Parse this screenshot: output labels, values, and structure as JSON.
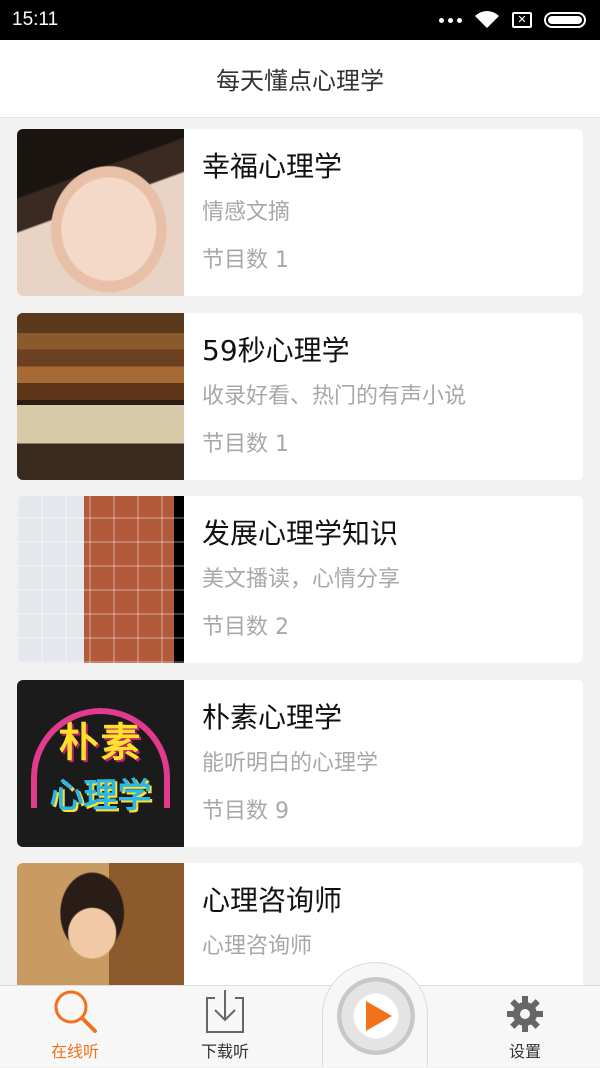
{
  "status_bar": {
    "time": "15:11",
    "icons": [
      "more-dots-icon",
      "wifi-icon",
      "sim-off-icon",
      "battery-icon"
    ]
  },
  "header": {
    "title": "每天懂点心理学"
  },
  "programs": [
    {
      "name": "幸福心理学",
      "desc": "情感文摘",
      "count": "节目数 1"
    },
    {
      "name": "59秒心理学",
      "desc": "收录好看、热门的有声小说",
      "count": "节目数 1"
    },
    {
      "name": "发展心理学知识",
      "desc": "美文播读，心情分享",
      "count": "节目数 2"
    },
    {
      "name": "朴素心理学",
      "desc": "能听明白的心理学",
      "count": "节目数 9",
      "thumb_text": [
        "朴素",
        "心理学"
      ]
    },
    {
      "name": "心理咨询师",
      "desc": "心理咨询师",
      "count": ""
    }
  ],
  "tabs": [
    {
      "label": "在线听",
      "icon": "search-icon",
      "active": true
    },
    {
      "label": "下载听",
      "icon": "download-icon",
      "active": false
    },
    {
      "label": "",
      "icon": "play-icon",
      "active": false
    },
    {
      "label": "设置",
      "icon": "gear-icon",
      "active": false
    }
  ],
  "colors": {
    "accent": "#f2711c",
    "muted_text": "#a8a8a8"
  }
}
